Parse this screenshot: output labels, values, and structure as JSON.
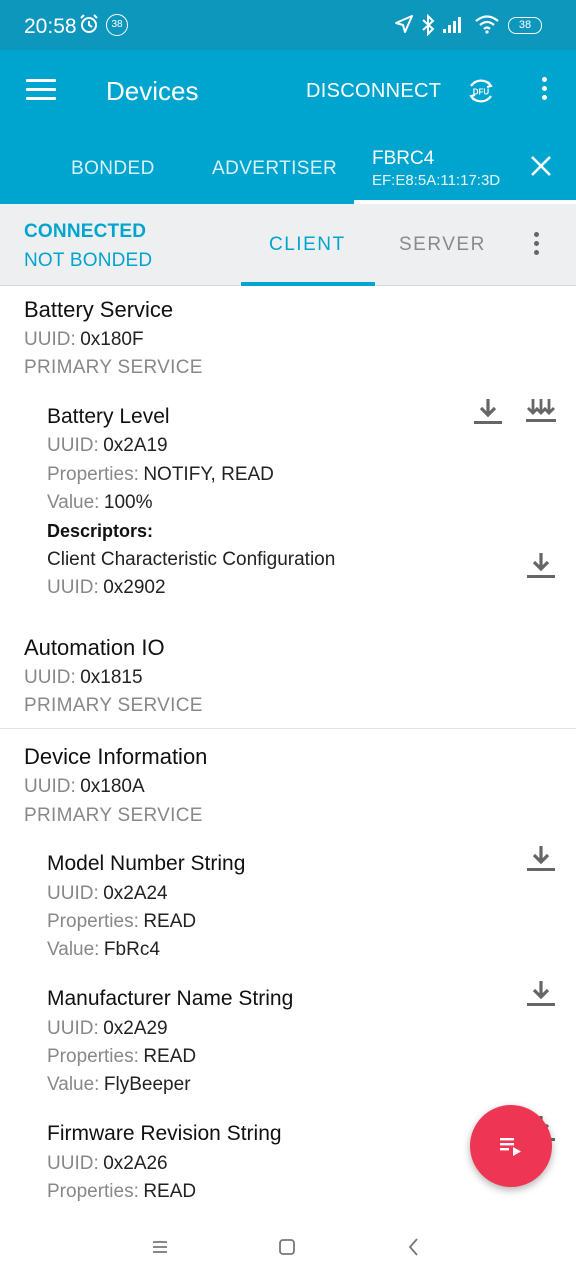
{
  "status_bar": {
    "time": "20:58",
    "notification_badge": "38",
    "battery": "38",
    "icons": [
      "alarm-icon",
      "location-icon",
      "bluetooth-icon",
      "signal-icon",
      "wifi-icon",
      "battery-icon"
    ]
  },
  "app_bar": {
    "title": "Devices",
    "disconnect_label": "DISCONNECT",
    "dfu_label": "DFU"
  },
  "tabs": {
    "bonded": "BONDED",
    "advertiser": "ADVERTISER",
    "device_name": "FBRC4",
    "device_address": "EF:E8:5A:11:17:3D"
  },
  "connection": {
    "status": "CONNECTED",
    "bond": "NOT BONDED",
    "client_tab": "CLIENT",
    "server_tab": "SERVER"
  },
  "labels": {
    "uuid": "UUID:",
    "properties": "Properties:",
    "value": "Value:",
    "descriptors": "Descriptors:"
  },
  "services": [
    {
      "name": "Battery Service",
      "uuid": "0x180F",
      "type": "PRIMARY SERVICE",
      "characteristics": [
        {
          "name": "Battery Level",
          "uuid": "0x2A19",
          "properties": "NOTIFY, READ",
          "value": "100%",
          "descriptors": [
            {
              "name": "Client Characteristic Configuration",
              "uuid": "0x2902"
            }
          ]
        }
      ]
    },
    {
      "name": "Automation IO",
      "uuid": "0x1815",
      "type": "PRIMARY SERVICE",
      "characteristics": []
    },
    {
      "name": "Device Information",
      "uuid": "0x180A",
      "type": "PRIMARY SERVICE",
      "characteristics": [
        {
          "name": "Model Number String",
          "uuid": "0x2A24",
          "properties": "READ",
          "value": "FbRc4"
        },
        {
          "name": "Manufacturer Name String",
          "uuid": "0x2A29",
          "properties": "READ",
          "value": "FlyBeeper"
        },
        {
          "name": "Firmware Revision String",
          "uuid": "0x2A26",
          "properties": "READ"
        }
      ]
    }
  ],
  "colors": {
    "status_bar": "#0d97bd",
    "app_bar": "#00a5cf",
    "accent": "#00a5cf",
    "fab": "#ee3553"
  }
}
